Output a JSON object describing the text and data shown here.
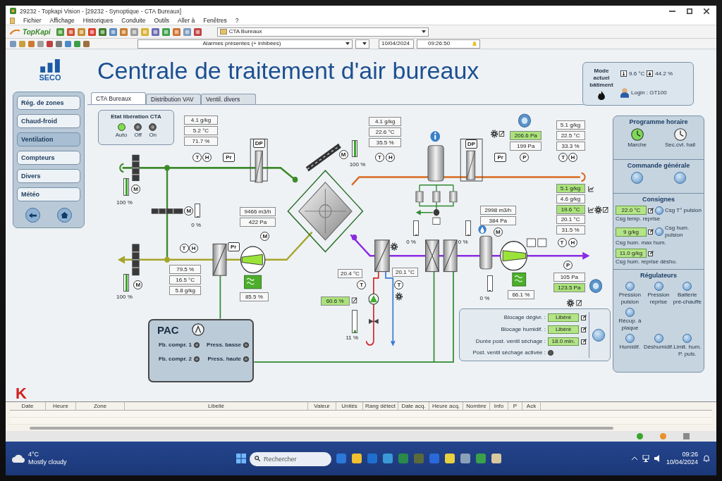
{
  "window": {
    "title": "29232 - Topkapi Vision - [29232 - Synoptique - CTA Bureaux]"
  },
  "menu": [
    "Fichier",
    "Affichage",
    "Historiques",
    "Conduite",
    "Outils",
    "Aller à",
    "Fenêtres",
    "?"
  ],
  "toolbar": {
    "brand": "TopKapi",
    "view": "CTA Bureaux",
    "alarm_filter": "Alarmes présentes (+ inhibées)",
    "date": "10/04/2024",
    "time": "09:26:50"
  },
  "header": {
    "logo": "SECO",
    "title": "Centrale de traitement d'air bureaux"
  },
  "building": {
    "mode_label": "Mode actuel bâtiment",
    "temperature": "9.6 °C",
    "humidity": "44.2 %",
    "login": "Login : GT100"
  },
  "sidebar": {
    "items": [
      {
        "label": "Rég. de zones",
        "selected": false
      },
      {
        "label": "Chaud-froid",
        "selected": false
      },
      {
        "label": "Ventilation",
        "selected": true
      },
      {
        "label": "Compteurs",
        "selected": false
      },
      {
        "label": "Divers",
        "selected": false
      },
      {
        "label": "Météo",
        "selected": false
      }
    ],
    "footer_logo": "K"
  },
  "tabs": [
    {
      "label": "CTA Bureaux",
      "selected": true
    },
    {
      "label": "Distribution VAV",
      "selected": false
    },
    {
      "label": "Ventil. divers",
      "selected": false
    }
  ],
  "release": {
    "title": "Etat libération CTA",
    "modes": [
      {
        "label": "Auto",
        "selected": true
      },
      {
        "label": "Off",
        "selected": false
      },
      {
        "label": "On",
        "selected": false
      }
    ]
  },
  "readings": [
    {
      "kind": "box",
      "value": "4.1 g/kg",
      "highlighted": false
    },
    {
      "kind": "box",
      "value": "5.2 °C",
      "highlighted": false
    },
    {
      "kind": "box",
      "value": "71.7 %",
      "highlighted": false
    },
    {
      "kind": "box",
      "value": "4.1 g/kg",
      "highlighted": false
    },
    {
      "kind": "box",
      "value": "22.6 °C",
      "highlighted": false
    },
    {
      "kind": "box",
      "value": "35.5 %",
      "highlighted": false
    },
    {
      "kind": "box",
      "value": "206.6 Pa",
      "highlighted": true
    },
    {
      "kind": "box",
      "value": "199 Pa",
      "highlighted": false
    },
    {
      "kind": "box",
      "value": "5.1 g/kg",
      "highlighted": false
    },
    {
      "kind": "box",
      "value": "22.5 °C",
      "highlighted": false
    },
    {
      "kind": "box",
      "value": "33.3 %",
      "highlighted": false
    },
    {
      "kind": "plain",
      "value": "100 %"
    },
    {
      "kind": "plain",
      "value": "0 %"
    },
    {
      "kind": "box",
      "value": "9466 m3/h",
      "highlighted": false
    },
    {
      "kind": "box",
      "value": "422 Pa",
      "highlighted": false
    },
    {
      "kind": "box",
      "value": "79.5 %",
      "highlighted": false
    },
    {
      "kind": "box",
      "value": "16.5 °C",
      "highlighted": false
    },
    {
      "kind": "box",
      "value": "5.8 g/kg",
      "highlighted": false
    },
    {
      "kind": "plain",
      "value": "100 %"
    },
    {
      "kind": "box",
      "value": "85.5 %",
      "highlighted": false
    },
    {
      "kind": "box",
      "value": "20.4 °C",
      "highlighted": false
    },
    {
      "kind": "box",
      "value": "60.6 %",
      "highlighted": true
    },
    {
      "kind": "plain",
      "value": "11 %"
    },
    {
      "kind": "box",
      "value": "20.1 °C",
      "highlighted": false
    },
    {
      "kind": "plain",
      "value": "0 %"
    },
    {
      "kind": "plain",
      "value": "0 %"
    },
    {
      "kind": "box",
      "value": "2998 m3/h",
      "highlighted": false
    },
    {
      "kind": "box",
      "value": "384 Pa",
      "highlighted": false
    },
    {
      "kind": "plain",
      "value": "0 %"
    },
    {
      "kind": "box",
      "value": "66.1 %",
      "highlighted": false
    },
    {
      "kind": "box",
      "value": "5.1 g/kg",
      "highlighted": true
    },
    {
      "kind": "box",
      "value": "4.6 g/kg",
      "highlighted": false
    },
    {
      "kind": "box",
      "value": "19.6 °C",
      "highlighted": true
    },
    {
      "kind": "box",
      "value": "20.1 °C",
      "highlighted": false
    },
    {
      "kind": "box",
      "value": "31.5 %",
      "highlighted": false
    },
    {
      "kind": "box",
      "value": "105 Pa",
      "highlighted": false
    },
    {
      "kind": "box",
      "value": "123.5 Pa",
      "highlighted": true
    },
    {
      "kind": "plain",
      "value": "100 %"
    }
  ],
  "sensors": [
    {
      "kind": "round",
      "label": "M"
    },
    {
      "kind": "round",
      "label": "T"
    },
    {
      "kind": "round",
      "label": "H"
    },
    {
      "kind": "square",
      "label": "Pr"
    },
    {
      "kind": "square",
      "label": "DP"
    },
    {
      "kind": "round",
      "label": "M"
    },
    {
      "kind": "round",
      "label": "T"
    },
    {
      "kind": "round",
      "label": "H"
    },
    {
      "kind": "square",
      "label": "Pr"
    },
    {
      "kind": "round",
      "label": "M"
    },
    {
      "kind": "round",
      "label": "M"
    },
    {
      "kind": "round",
      "label": "T"
    },
    {
      "kind": "round",
      "label": "H"
    },
    {
      "kind": "square",
      "label": "DP"
    },
    {
      "kind": "square",
      "label": "Pr"
    },
    {
      "kind": "round",
      "label": "P"
    },
    {
      "kind": "round",
      "label": "T"
    },
    {
      "kind": "round",
      "label": "H"
    },
    {
      "kind": "round",
      "label": "M"
    },
    {
      "kind": "round",
      "label": "T"
    },
    {
      "kind": "round",
      "label": "H"
    },
    {
      "kind": "round",
      "label": "P"
    },
    {
      "kind": "round",
      "label": "T"
    },
    {
      "kind": "round",
      "label": "T"
    },
    {
      "kind": "round",
      "label": "M"
    }
  ],
  "gauges": [
    {
      "level": 1
    },
    {
      "level": 0
    },
    {
      "level": 1
    },
    {
      "level": 1
    },
    {
      "level": 0.1
    },
    {
      "level": 0
    },
    {
      "level": 0
    },
    {
      "level": 0
    }
  ],
  "pac": {
    "title": "PAC",
    "items": [
      {
        "label": "Fb. compr. 1"
      },
      {
        "label": "Press. basse"
      },
      {
        "label": "Fb. compr. 2"
      },
      {
        "label": "Press. haute"
      }
    ]
  },
  "drying": {
    "items": [
      {
        "label": "Blocage dégivr. :",
        "value": "Libéré"
      },
      {
        "label": "Blocage humidif. :",
        "value": "Libéré"
      },
      {
        "label": "Durée post. ventil séchage :",
        "value": "18.0 min."
      },
      {
        "label": "Post. ventil séchage activée :"
      }
    ]
  },
  "schedule": {
    "title": "Programme horaire",
    "items": [
      {
        "label": "Marche",
        "on": true
      },
      {
        "label": "Sec.cvt. hall",
        "on": false
      }
    ]
  },
  "general_command": {
    "title": "Commande générale"
  },
  "setpoints": {
    "title": "Consignes",
    "items": [
      {
        "value": "22.0 °C",
        "caption": "Csg temp. reprise",
        "button": "Csg T° pulsion"
      },
      {
        "value": "9 g/kg",
        "caption": "Csg hum. max hum.",
        "button": "Csg hum. pulsion"
      },
      {
        "value": "11.0 g/kg",
        "caption": "Csg hum. reprise déshu."
      }
    ]
  },
  "regulators": {
    "title": "Régulateurs",
    "rows": [
      [
        "Pression pulsion",
        "Pression reprise",
        "Batterie pré-chauffe"
      ],
      [
        "Récup. à plaque"
      ],
      [
        "Humidif.",
        "Déshumidif.",
        "Limit. hum. P. puls."
      ]
    ]
  },
  "alarm_table": {
    "columns": [
      "Date",
      "Heure",
      "Zone",
      "Libellé",
      "Valeur",
      "Unités",
      "Rang détect",
      "Date acq.",
      "Heure acq.",
      "Nombre",
      "Info",
      "P",
      "Ack"
    ]
  },
  "taskbar": {
    "temperature": "4°C",
    "weather": "Mostly cloudy",
    "search": {
      "placeholder": "Rechercher"
    },
    "time": "09:26",
    "date": "10/04/2024"
  }
}
